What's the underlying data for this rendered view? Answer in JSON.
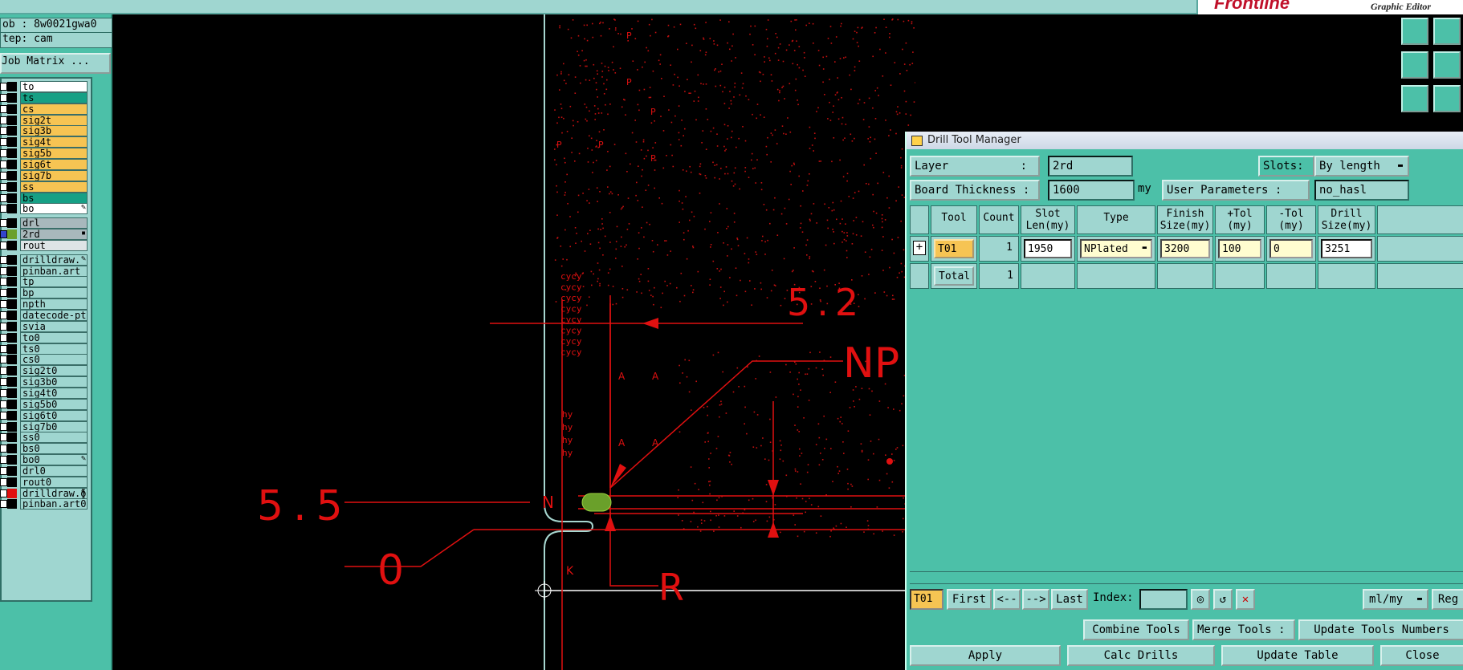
{
  "header": {
    "brand": "Frontline",
    "subtitle": "Graphic Editor"
  },
  "left_panel": {
    "job_label": "ob : 8w0021gwa0",
    "step_label": "tep: cam",
    "job_matrix_button": "Job Matrix ...",
    "layers": [
      {
        "name": "to",
        "bg": "#ffffff",
        "group": 0
      },
      {
        "name": "ts",
        "bg": "#16a085",
        "group": 0
      },
      {
        "name": "cs",
        "bg": "#f6c453",
        "group": 0
      },
      {
        "name": "sig2t",
        "bg": "#f6c453",
        "group": 0
      },
      {
        "name": "sig3b",
        "bg": "#f6c453",
        "group": 0
      },
      {
        "name": "sig4t",
        "bg": "#f6c453",
        "group": 0
      },
      {
        "name": "sig5b",
        "bg": "#f6c453",
        "group": 0
      },
      {
        "name": "sig6t",
        "bg": "#f6c453",
        "group": 0
      },
      {
        "name": "sig7b",
        "bg": "#f6c453",
        "group": 0
      },
      {
        "name": "ss",
        "bg": "#f6c453",
        "group": 0
      },
      {
        "name": "bs",
        "bg": "#16a085",
        "group": 0
      },
      {
        "name": "bo",
        "bg": "#ffffff",
        "group": 0,
        "flag": "✎"
      },
      {
        "name": "drl",
        "bg": "#a8b8bc",
        "group": 1
      },
      {
        "name": "2rd",
        "bg": "#a8b8bc",
        "group": 1,
        "selected": true,
        "swatch": "#6aa02a",
        "flag": "▪"
      },
      {
        "name": "rout",
        "bg": "#dde4e6",
        "group": 1
      },
      {
        "name": "drilldraw.",
        "bg": "#9fd6d0",
        "group": 2,
        "flag": "✎"
      },
      {
        "name": "pinban.art",
        "bg": "#9fd6d0",
        "group": 2
      },
      {
        "name": "tp",
        "bg": "#9fd6d0",
        "group": 2
      },
      {
        "name": "bp",
        "bg": "#9fd6d0",
        "group": 2
      },
      {
        "name": "npth",
        "bg": "#9fd6d0",
        "group": 2
      },
      {
        "name": "datecode-pte",
        "bg": "#9fd6d0",
        "group": 2
      },
      {
        "name": "svia",
        "bg": "#9fd6d0",
        "group": 2
      },
      {
        "name": "to0",
        "bg": "#9fd6d0",
        "group": 2
      },
      {
        "name": "ts0",
        "bg": "#9fd6d0",
        "group": 2
      },
      {
        "name": "cs0",
        "bg": "#9fd6d0",
        "group": 2
      },
      {
        "name": "sig2t0",
        "bg": "#9fd6d0",
        "group": 2
      },
      {
        "name": "sig3b0",
        "bg": "#9fd6d0",
        "group": 2
      },
      {
        "name": "sig4t0",
        "bg": "#9fd6d0",
        "group": 2
      },
      {
        "name": "sig5b0",
        "bg": "#9fd6d0",
        "group": 2
      },
      {
        "name": "sig6t0",
        "bg": "#9fd6d0",
        "group": 2
      },
      {
        "name": "sig7b0",
        "bg": "#9fd6d0",
        "group": 2
      },
      {
        "name": "ss0",
        "bg": "#9fd6d0",
        "group": 2
      },
      {
        "name": "bs0",
        "bg": "#9fd6d0",
        "group": 2
      },
      {
        "name": "bo0",
        "bg": "#9fd6d0",
        "group": 2,
        "flag": "✎"
      },
      {
        "name": "drl0",
        "bg": "#9fd6d0",
        "group": 2
      },
      {
        "name": "rout0",
        "bg": "#9fd6d0",
        "group": 2
      },
      {
        "name": "drilldraw.ɸ",
        "bg": "#9fd6d0",
        "group": 2,
        "swatch": "#e01010",
        "flag": "✎"
      },
      {
        "name": "pinban.art0",
        "bg": "#9fd6d0",
        "group": 2
      }
    ]
  },
  "canvas": {
    "dim_5_2": "5.2",
    "dim_5_5": "5.5",
    "dim_0": "0",
    "label_np": "NP",
    "label_n": "N",
    "label_r": "R",
    "marker_p": "P",
    "marker_k": "K",
    "marker_a": "A",
    "cycy": "cycy",
    "hy": "hy"
  },
  "dialog": {
    "title": "Drill Tool Manager",
    "layer_label": "Layer",
    "layer_colon": ":",
    "layer_value": "2rd",
    "slots_label": "Slots:",
    "slots_value": "By length",
    "board_thickness_label": "Board Thickness :",
    "board_thickness_value": "1600",
    "board_thickness_unit": "my",
    "user_params_label": "User Parameters :",
    "user_params_value": "no_hasl",
    "columns": [
      "Tool",
      "Count",
      "Slot\nLen(my)",
      "Type",
      "Finish\nSize(my)",
      "+Tol\n(my)",
      "-Tol\n(my)",
      "Drill\nSize(my)"
    ],
    "rows": [
      {
        "tool": "T01",
        "count": "1",
        "slot_len": "1950",
        "type": "NPlated",
        "finish": "3200",
        "tol_plus": "100",
        "tol_minus": "0",
        "drill": "3251"
      }
    ],
    "total_label": "Total",
    "total_count": "1",
    "nav": {
      "current_tool": "T01",
      "first": "First",
      "prev": "<--",
      "next": "-->",
      "last": "Last",
      "index_label": "Index:",
      "units": "ml/my",
      "reg": "Reg"
    },
    "actions": {
      "combine": "Combine Tools",
      "merge_label": "Merge Tools :",
      "update_numbers": "Update Tools Numbers",
      "apply": "Apply",
      "calc": "Calc Drills",
      "update_table": "Update Table",
      "close": "Close"
    }
  }
}
